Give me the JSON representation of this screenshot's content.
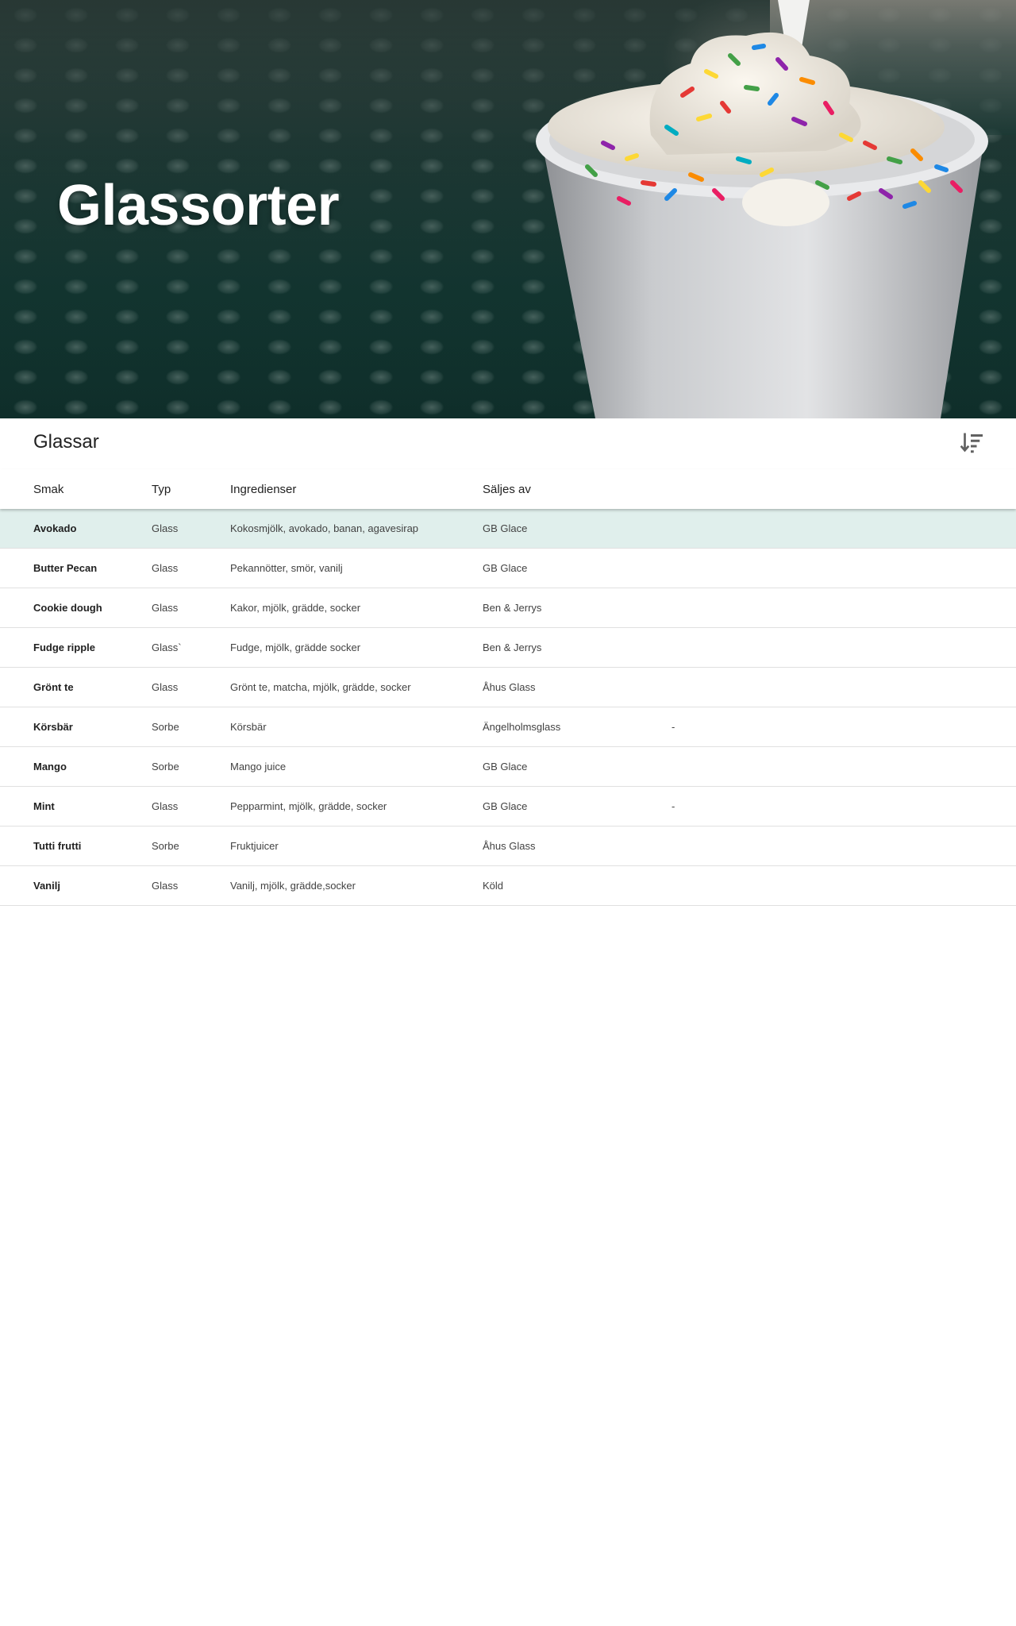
{
  "hero": {
    "title": "Glassorter"
  },
  "card": {
    "title": "Glassar",
    "sort_icon": "sort-descending-icon"
  },
  "table": {
    "columns": [
      "Smak",
      "Typ",
      "Ingredienser",
      "Säljes av",
      ""
    ],
    "rows": [
      {
        "flavor": "Avokado",
        "type": "Glass",
        "ingredients": "Kokosmjölk, avokado, banan, agavesirap",
        "seller": "GB Glace",
        "extra": "",
        "selected": true
      },
      {
        "flavor": "Butter Pecan",
        "type": "Glass",
        "ingredients": "Pekannötter, smör, vanilj",
        "seller": "GB Glace",
        "extra": ""
      },
      {
        "flavor": "Cookie dough",
        "type": "Glass",
        "ingredients": "Kakor, mjölk, grädde, socker",
        "seller": "Ben & Jerrys",
        "extra": ""
      },
      {
        "flavor": "Fudge ripple",
        "type": "Glass`",
        "ingredients": "Fudge, mjölk, grädde socker",
        "seller": "Ben & Jerrys",
        "extra": ""
      },
      {
        "flavor": "Grönt te",
        "type": "Glass",
        "ingredients": "Grönt te, matcha, mjölk, grädde, socker",
        "seller": "Åhus Glass",
        "extra": ""
      },
      {
        "flavor": "Körsbär",
        "type": "Sorbe",
        "ingredients": "Körsbär",
        "seller": "Ängelholmsglass",
        "extra": "-"
      },
      {
        "flavor": "Mango",
        "type": "Sorbe",
        "ingredients": "Mango juice",
        "seller": "GB Glace",
        "extra": ""
      },
      {
        "flavor": "Mint",
        "type": "Glass",
        "ingredients": "Pepparmint, mjölk, grädde, socker",
        "seller": "GB Glace",
        "extra": "-"
      },
      {
        "flavor": "Tutti frutti",
        "type": "Sorbe",
        "ingredients": "Fruktjuicer",
        "seller": "Åhus Glass",
        "extra": ""
      },
      {
        "flavor": "Vanilj",
        "type": "Glass",
        "ingredients": "Vanilj, mjölk, grädde,socker",
        "seller": "Köld",
        "extra": ""
      }
    ]
  }
}
